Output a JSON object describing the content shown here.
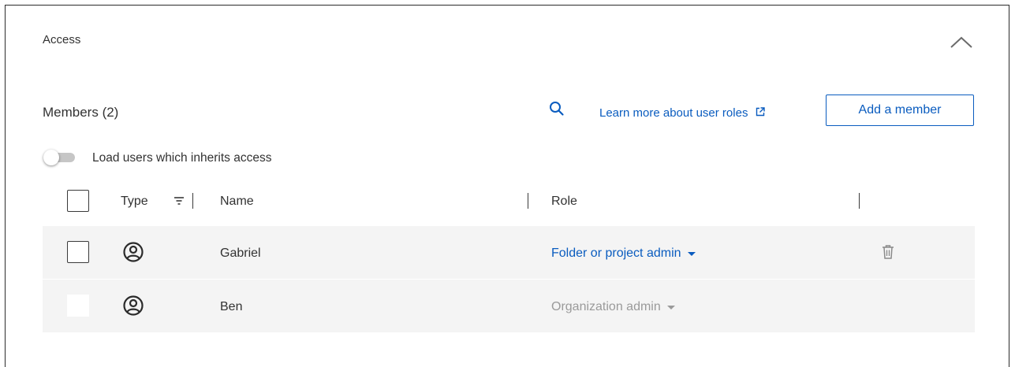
{
  "section": {
    "title": "Access",
    "collapse_icon": "chevron-up-icon"
  },
  "members": {
    "title": "Members (2)",
    "search_icon": "search-icon",
    "learn_more_label": "Learn more about user roles",
    "learn_more_icon": "external-link-icon",
    "add_member_label": "Add a member"
  },
  "inherit_toggle": {
    "label": "Load users which inherits access",
    "checked": false
  },
  "table": {
    "headers": {
      "type": "Type",
      "name": "Name",
      "role": "Role"
    },
    "rows": [
      {
        "type_icon": "user-icon",
        "name": "Gabriel",
        "role": "Folder or project admin",
        "editable": true,
        "delete_icon": "trash-icon"
      },
      {
        "type_icon": "user-icon",
        "name": "Ben",
        "role": "Organization admin",
        "editable": false
      }
    ]
  },
  "colors": {
    "accent": "#0a5cbf",
    "row_background": "#f4f4f4",
    "disabled_text": "#9a9a9a",
    "text": "#323232"
  }
}
